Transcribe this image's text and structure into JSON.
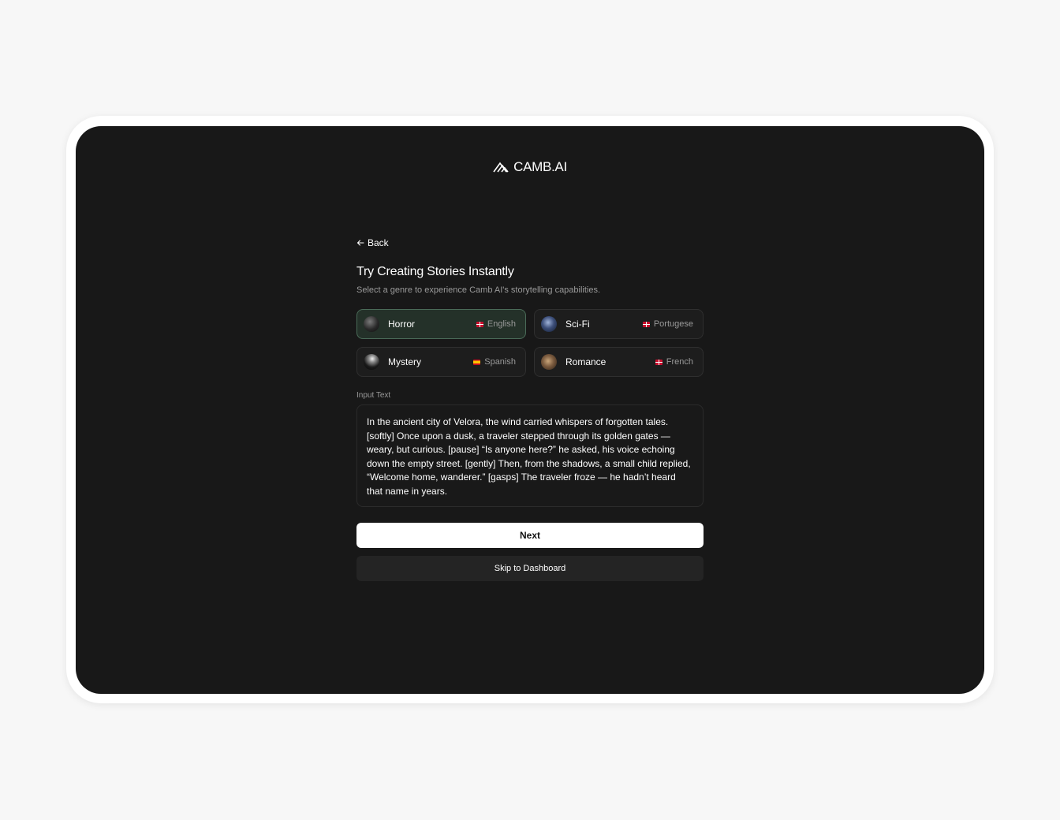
{
  "brand": {
    "name": "CAMB.AI"
  },
  "nav": {
    "back_label": "Back"
  },
  "header": {
    "title": "Try Creating Stories Instantly",
    "subtitle": "Select a genre to experience Camb AI's storytelling capabilities."
  },
  "genres": [
    {
      "label": "Horror",
      "language": "English",
      "flag": "english-flag",
      "selected": true
    },
    {
      "label": "Sci-Fi",
      "language": "Portugese",
      "flag": "english-flag",
      "selected": false
    },
    {
      "label": "Mystery",
      "language": "Spanish",
      "flag": "spanish-flag",
      "selected": false
    },
    {
      "label": "Romance",
      "language": "French",
      "flag": "english-flag",
      "selected": false
    }
  ],
  "input": {
    "label": "Input Text",
    "value": "In the ancient city of Velora, the wind carried whispers of forgotten tales. [softly] Once upon a dusk, a traveler stepped through its golden gates — weary, but curious. [pause] “Is anyone here?” he asked, his voice echoing down the empty street. [gently] Then, from the shadows, a small child replied, “Welcome home, wanderer.” [gasps] The traveler froze — he hadn’t heard that name in years."
  },
  "actions": {
    "next_label": "Next",
    "skip_label": "Skip to Dashboard"
  },
  "colors": {
    "background": "#f7f7f7",
    "screen": "#181818",
    "selected_card": "#243129",
    "selected_border": "#4a6b58",
    "primary_button": "#ffffff"
  }
}
